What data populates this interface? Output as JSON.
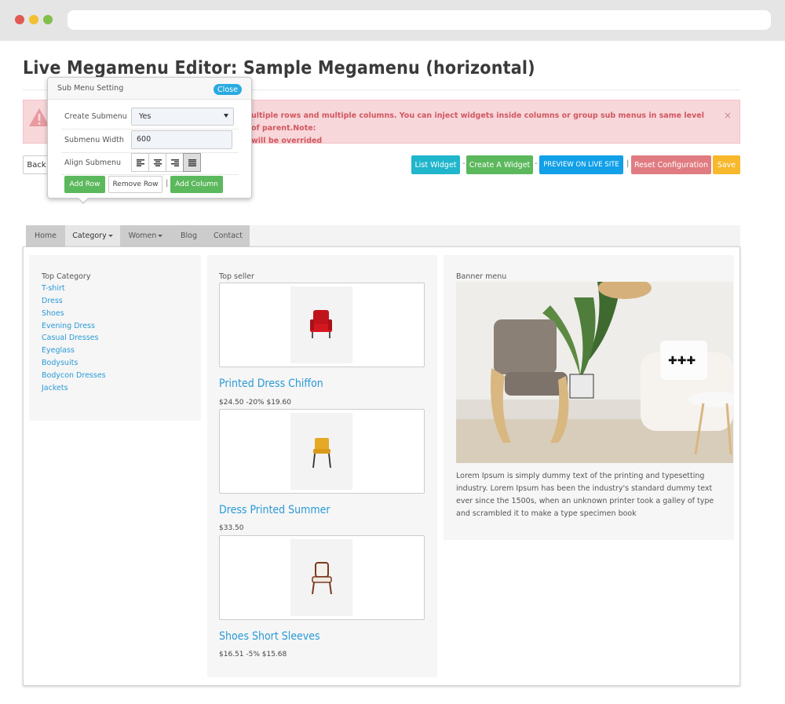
{
  "page": {
    "title": "Live Megamenu Editor: Sample Megamenu (horizontal)"
  },
  "alert": {
    "text_line1": "ultiple rows and multiple columns. You can inject widgets inside columns or group sub menus in same level of parent.Note:",
    "text_line2": "will be overrided",
    "close": "×"
  },
  "toolbar": {
    "back": "Back",
    "list_widget": "List Widget",
    "create_widget": "Create A Widget",
    "preview": "PREVIEW ON LIVE SITE",
    "reset": "Reset Configuration",
    "save": "Save",
    "sep_dash": "-",
    "sep_bar": "|",
    "colors": {
      "info": "#20b6cc",
      "success": "#5cb85c",
      "primary": "#12a0e8",
      "danger": "#e07c81",
      "warning": "#f7b82c"
    }
  },
  "popover": {
    "title": "Sub Menu Setting",
    "close": "Close",
    "create_submenu_label": "Create Submenu",
    "create_submenu_value": "Yes",
    "width_label": "Submenu Width",
    "width_value": "600",
    "align_label": "Align Submenu",
    "add_row": "Add Row",
    "remove_row": "Remove Row",
    "sep": "|",
    "add_column": "Add Column"
  },
  "menu": {
    "items": [
      {
        "label": "Home"
      },
      {
        "label": "Category"
      },
      {
        "label": "Women"
      },
      {
        "label": "Blog"
      },
      {
        "label": "Contact"
      }
    ]
  },
  "mega": {
    "category": {
      "title": "Top Category",
      "links": [
        "T-shirt",
        "Dress",
        "Shoes",
        "Evening Dress",
        "Casual Dresses",
        "Eyeglass",
        "Bodysuits",
        "Bodycon Dresses",
        "Jackets"
      ]
    },
    "seller": {
      "title": "Top seller",
      "products": [
        {
          "name": "Printed Dress Chiffon",
          "price": "$24.50 -20% $19.60"
        },
        {
          "name": "Dress Printed Summer",
          "price": "$33.50"
        },
        {
          "name": "Shoes Short Sleeves",
          "price": "$16.51 -5% $15.68"
        }
      ]
    },
    "banner": {
      "title": "Banner menu",
      "text": "Lorem Ipsum is simply dummy text of the printing and typesetting industry. Lorem Ipsum has been the industry's standard dummy text ever since the 1500s, when an unknown printer took a galley of type and scrambled it to make a type specimen book"
    }
  }
}
